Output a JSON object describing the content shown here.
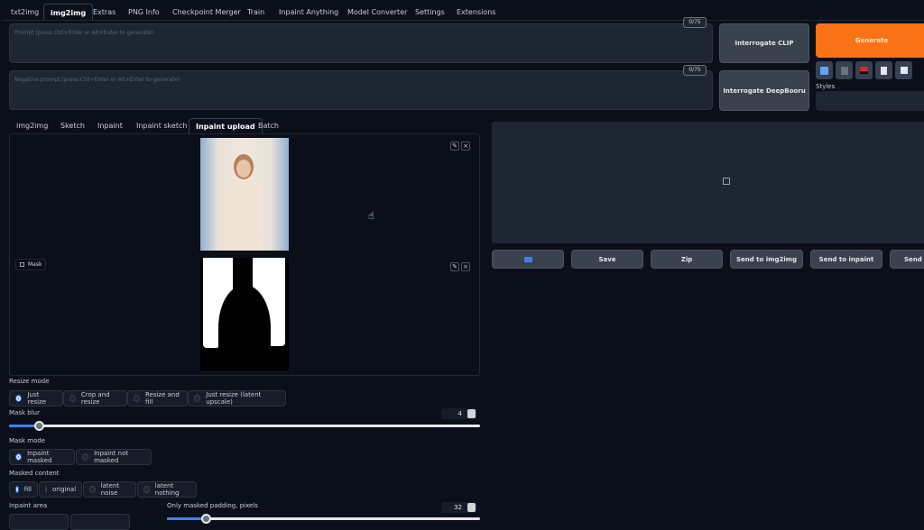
{
  "top_tabs": [
    "txt2img",
    "img2img",
    "Extras",
    "PNG Info",
    "Checkpoint Merger",
    "Train",
    "Inpaint Anything",
    "Model Converter",
    "Settings",
    "Extensions"
  ],
  "prompt": {
    "placeholder": "Prompt (press Ctrl+Enter or Alt+Enter to generate)",
    "counter": "0/75"
  },
  "negative_prompt": {
    "placeholder": "Negative prompt (press Ctrl+Enter or Alt+Enter to generate)",
    "counter": "0/75"
  },
  "buttons": {
    "interrogate_clip": "Interrogate CLIP",
    "interrogate_deepbooru": "Interrogate DeepBooru",
    "generate": "Generate"
  },
  "styles_label": "Styles",
  "sub_tabs": [
    "img2img",
    "Sketch",
    "Inpaint",
    "Inpaint sketch",
    "Inpaint upload",
    "Batch"
  ],
  "mask_label": "Mask",
  "output_buttons": [
    "Save",
    "Zip",
    "Send to img2img",
    "Send to inpaint",
    "Send to extras"
  ],
  "resize_mode": {
    "label": "Resize mode",
    "options": [
      "Just resize",
      "Crop and resize",
      "Resize and fill",
      "Just resize (latent upscale)"
    ],
    "selected": 0
  },
  "mask_blur": {
    "label": "Mask blur",
    "value": "4",
    "min": 0,
    "max": 64
  },
  "mask_mode": {
    "label": "Mask mode",
    "options": [
      "Inpaint masked",
      "Inpaint not masked"
    ],
    "selected": 0
  },
  "masked_content": {
    "label": "Masked content",
    "options": [
      "fill",
      "original",
      "latent noise",
      "latent nothing"
    ],
    "selected": 0
  },
  "inpaint_area": {
    "label": "Inpaint area"
  },
  "padding": {
    "label": "Only masked padding, pixels",
    "value": "32",
    "min": 0,
    "max": 256
  },
  "colors": {
    "accent": "#f97316",
    "bg": "#0b0f19"
  }
}
